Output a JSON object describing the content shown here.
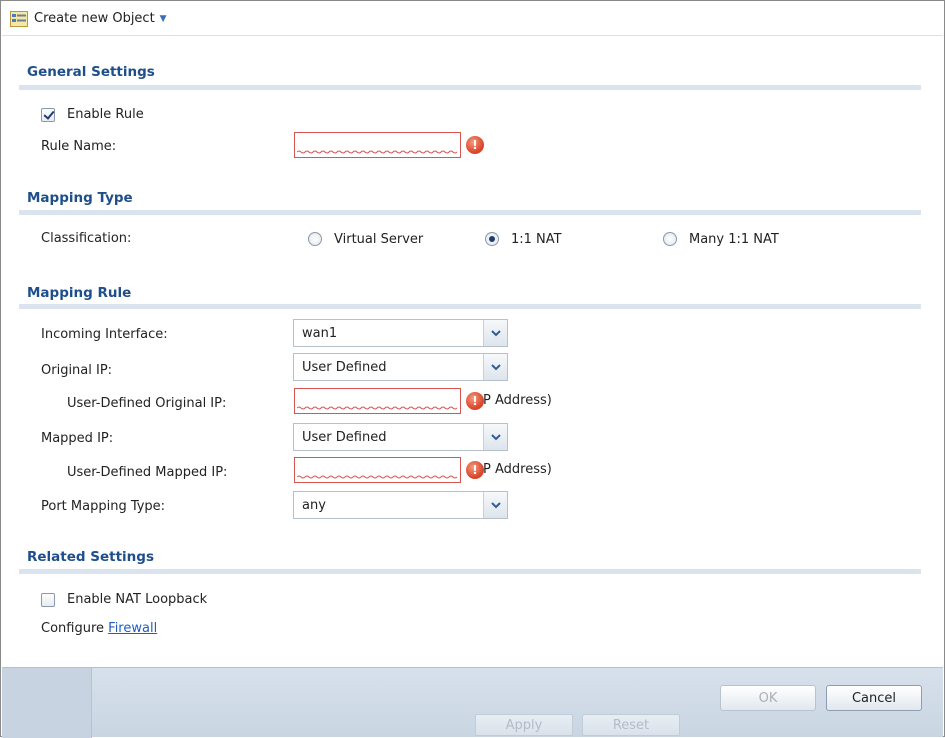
{
  "toolbar": {
    "create_label": "Create new Object"
  },
  "general": {
    "title": "General Settings",
    "enable_rule_label": "Enable Rule",
    "rule_name_label": "Rule Name:"
  },
  "mapping_type": {
    "title": "Mapping Type",
    "classification_label": "Classification:",
    "options": [
      "Virtual Server",
      "1:1 NAT",
      "Many 1:1 NAT"
    ]
  },
  "mapping_rule": {
    "title": "Mapping Rule",
    "incoming_interface_label": "Incoming Interface:",
    "incoming_interface_value": "wan1",
    "original_ip_label": "Original IP:",
    "original_ip_value": "User Defined",
    "user_defined_original_ip_label": "User-Defined Original IP:",
    "mapped_ip_label": "Mapped IP:",
    "mapped_ip_value": "User Defined",
    "user_defined_mapped_ip_label": "User-Defined Mapped IP:",
    "ip_address_hint": "P Address)",
    "port_mapping_type_label": "Port Mapping Type:",
    "port_mapping_type_value": "any"
  },
  "related": {
    "title": "Related Settings",
    "enable_nat_loopback_label": "Enable NAT Loopback",
    "configure_label": "Configure",
    "firewall_link": "Firewall"
  },
  "footer": {
    "ok_label": "OK",
    "cancel_label": "Cancel",
    "apply_label": "Apply",
    "reset_label": "Reset"
  },
  "colors": {
    "section_title": "#1f4f8b",
    "error": "#d9442a",
    "link": "#1f5fc1"
  }
}
